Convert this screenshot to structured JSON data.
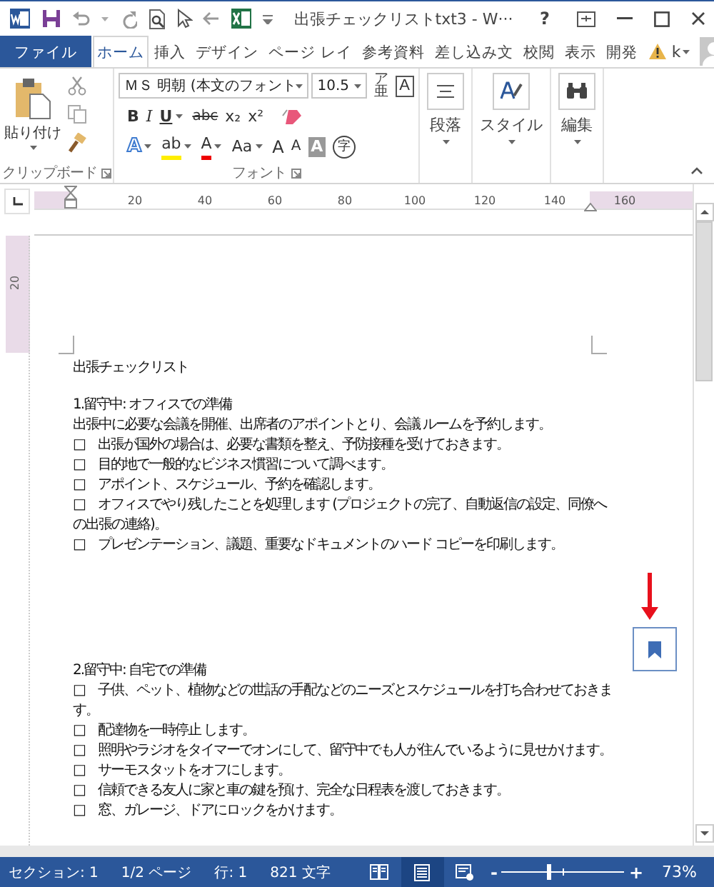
{
  "title_bar": {
    "title": "出張チェックリストtxt3 - W···",
    "help": "?"
  },
  "tabs": [
    {
      "label": "ファイル",
      "kind": "file",
      "selected": false
    },
    {
      "label": "ホーム",
      "kind": "tab",
      "selected": true
    },
    {
      "label": "挿入",
      "kind": "tab",
      "selected": false
    },
    {
      "label": "デザイン",
      "kind": "tab",
      "selected": false
    },
    {
      "label": "ページ レイ",
      "kind": "tab",
      "selected": false
    },
    {
      "label": "参考資料",
      "kind": "tab",
      "selected": false
    },
    {
      "label": "差し込み文",
      "kind": "tab",
      "selected": false
    },
    {
      "label": "校閲",
      "kind": "tab",
      "selected": false
    },
    {
      "label": "表示",
      "kind": "tab",
      "selected": false
    },
    {
      "label": "開発",
      "kind": "tab",
      "selected": false
    }
  ],
  "account": {
    "user": "k"
  },
  "ribbon": {
    "clipboard": {
      "paste": "貼り付け",
      "label": "クリップボード"
    },
    "font": {
      "font_name": "ＭＳ 明朝 (本文のフォント",
      "font_size": "10.5",
      "phonetic": "ア亜",
      "border": "A",
      "label": "フォント",
      "row1": [
        {
          "label": "B",
          "kind": "bold",
          "dropdown": false
        },
        {
          "label": "I",
          "kind": "italic",
          "dropdown": false
        },
        {
          "label": "U",
          "kind": "underline",
          "dropdown": true
        },
        {
          "label": "abc",
          "kind": "strike",
          "dropdown": false
        },
        {
          "label": "x₂",
          "kind": "plain",
          "dropdown": false
        },
        {
          "label": "x²",
          "kind": "plain",
          "dropdown": false
        }
      ],
      "row2": [
        {
          "label": "A",
          "kind": "effect",
          "dropdown": true
        },
        {
          "label": "ab",
          "kind": "highlight",
          "dropdown": true
        },
        {
          "label": "A",
          "kind": "color",
          "dropdown": true
        },
        {
          "label": "Aa",
          "kind": "plain",
          "dropdown": true
        },
        {
          "label": "A",
          "kind": "grow",
          "dropdown": false
        },
        {
          "label": "A",
          "kind": "shrink",
          "dropdown": false
        },
        {
          "label": "A",
          "kind": "shade",
          "dropdown": false
        },
        {
          "label": "字",
          "kind": "enclose",
          "dropdown": false
        }
      ]
    },
    "groups": [
      {
        "label": "段落",
        "kind": "paragraph"
      },
      {
        "label": "スタイル",
        "kind": "styles"
      },
      {
        "label": "編集",
        "kind": "editing"
      }
    ]
  },
  "ruler": {
    "numbers": [
      "20",
      "40",
      "60",
      "80",
      "100",
      "120",
      "140",
      "160"
    ],
    "vertical_number": "20"
  },
  "document": {
    "title": "出張チェックリスト",
    "sections": [
      {
        "heading": "1.留守中: オフィスでの準備",
        "paragraphs": [
          "出張中に必要な会議を開催、出席者のアポイントとり、会議 ルームを予約します。",
          "□　出張が国外の場合は、必要な書類を整え、予防接種を受けておきます。",
          "□　目的地で一般的なビジネス慣習について調べます。",
          "□　アポイント、スケジュール、予約を確認します。",
          "□　オフィスでやり残したことを処理します (プロジェクトの完了、自動返信の設定、同僚への出張の連絡)。",
          "□　プレゼンテーション、議題、重要なドキュメントのハード コピーを印刷します。"
        ]
      },
      {
        "heading": "2.留守中: 自宅での準備",
        "paragraphs": [
          "□　子供、ペット、植物などの世話の手配などのニーズとスケジュールを打ち合わせておきます。",
          "□　配達物を一時停止 します。",
          "□　照明やラジオをタイマーでオンにして、留守中でも人が住んでいるように見せかけます。",
          "□　サーモスタットをオフにします。",
          "□　信頼できる友人に家と車の鍵を預け、完全な日程表を渡しておきます。",
          "□　窓、ガレージ、ドアにロックをかけます。"
        ]
      }
    ]
  },
  "status_bar": {
    "section": "セクション: 1",
    "page": "1/2 ページ",
    "line": "行: 1",
    "words": "821 文字",
    "views": [
      {
        "kind": "read",
        "selected": false
      },
      {
        "kind": "print",
        "selected": true
      },
      {
        "kind": "web",
        "selected": false
      }
    ],
    "zoom": {
      "minus": "-",
      "plus": "+",
      "level": 0.38,
      "percent": "73%"
    }
  }
}
